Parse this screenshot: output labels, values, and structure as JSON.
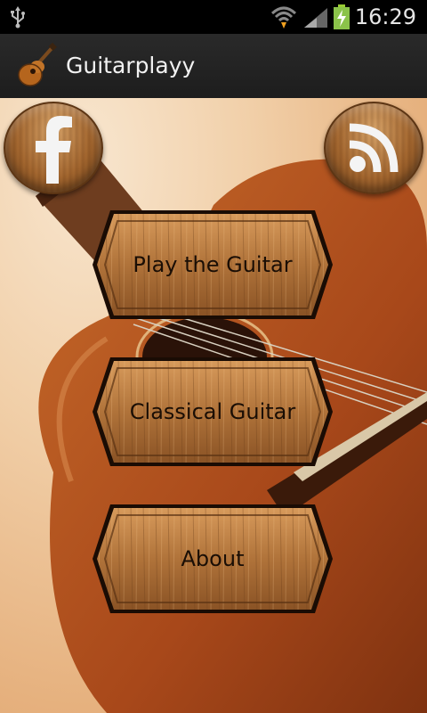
{
  "status_bar": {
    "time": "16:29",
    "icons": [
      "usb-icon",
      "wifi-icon",
      "signal-icon",
      "battery-charging-icon"
    ]
  },
  "app_bar": {
    "title": "Guitarplayy",
    "icon": "guitar-icon"
  },
  "social": {
    "facebook_icon": "facebook-icon",
    "rss_icon": "rss-icon"
  },
  "menu": {
    "items": [
      {
        "label": "Play the Guitar"
      },
      {
        "label": "Classical Guitar"
      },
      {
        "label": "About"
      }
    ]
  },
  "colors": {
    "status_bar_bg": "#000000",
    "action_bar_bg": "#222222",
    "wood_light": "#b47a3e",
    "wood_dark": "#5c3514",
    "button_text": "#1a0e05"
  }
}
